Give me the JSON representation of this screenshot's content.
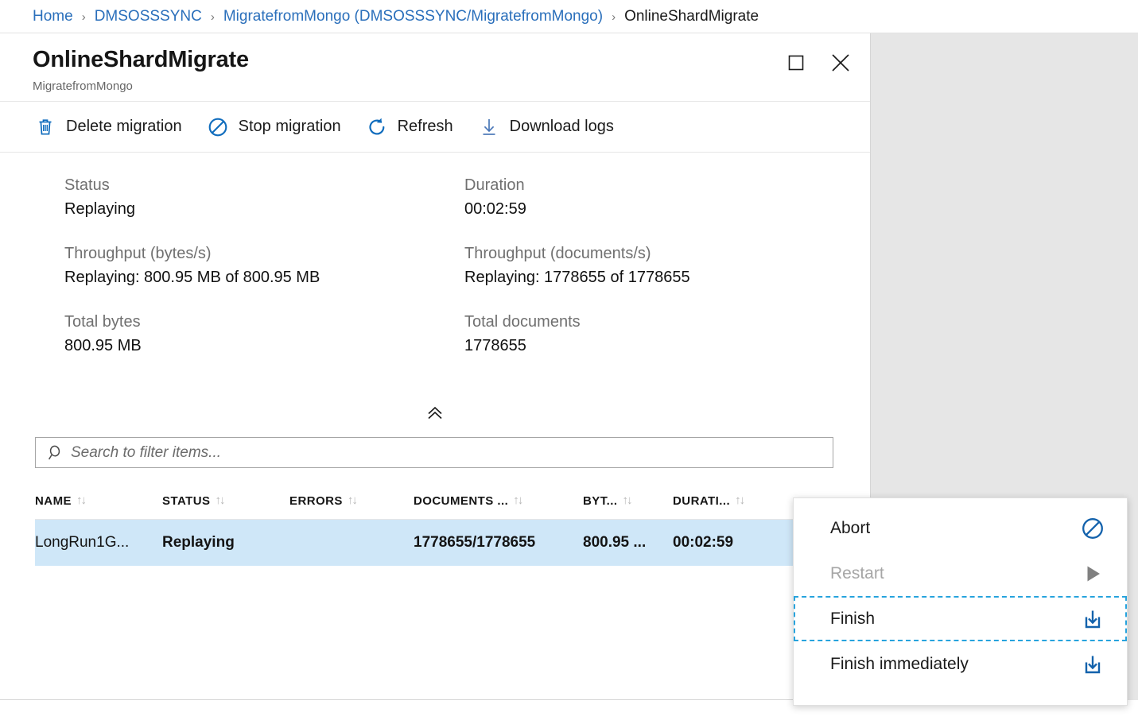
{
  "breadcrumb": {
    "separator": "›",
    "items": [
      {
        "label": "Home",
        "type": "link"
      },
      {
        "label": "DMSOSSSYNC",
        "type": "link"
      },
      {
        "label": "MigratefromMongo (DMSOSSSYNC/MigratefromMongo)",
        "type": "link"
      },
      {
        "label": "OnlineShardMigrate",
        "type": "current"
      }
    ]
  },
  "blade": {
    "title": "OnlineShardMigrate",
    "subtitle": "MigratefromMongo",
    "window_controls": [
      {
        "name": "maximize",
        "icon": "square-icon"
      },
      {
        "name": "close",
        "icon": "close-icon"
      }
    ]
  },
  "toolbar": {
    "items": [
      {
        "label": "Delete migration",
        "icon": "trash-icon"
      },
      {
        "label": "Stop migration",
        "icon": "no-entry-icon"
      },
      {
        "label": "Refresh",
        "icon": "refresh-icon"
      },
      {
        "label": "Download logs",
        "icon": "download-icon"
      }
    ]
  },
  "summary": {
    "left": [
      {
        "label": "Status",
        "value": "Replaying"
      },
      {
        "label": "Throughput (bytes/s)",
        "value": "Replaying: 800.95 MB of 800.95 MB"
      },
      {
        "label": "Total bytes",
        "value": "800.95 MB"
      }
    ],
    "right": [
      {
        "label": "Duration",
        "value": "00:02:59"
      },
      {
        "label": "Throughput (documents/s)",
        "value": "Replaying: 1778655 of 1778655"
      },
      {
        "label": "Total documents",
        "value": "1778655"
      }
    ],
    "collapse_icon": "double-chevron-up-icon"
  },
  "search": {
    "placeholder": "Search to filter items...",
    "value": "",
    "icon": "search-icon"
  },
  "table": {
    "sort_icon": "↑↓",
    "columns": [
      {
        "key": "name",
        "label": "NAME"
      },
      {
        "key": "status",
        "label": "STATUS"
      },
      {
        "key": "errors",
        "label": "ERRORS"
      },
      {
        "key": "documents",
        "label": "DOCUMENTS ..."
      },
      {
        "key": "bytes",
        "label": "BYT..."
      },
      {
        "key": "duration",
        "label": "DURATI..."
      }
    ],
    "rows": [
      {
        "name": "LongRun1G...",
        "status": "Replaying",
        "errors": "",
        "documents": "1778655/1778655",
        "bytes": "800.95 ...",
        "duration": "00:02:59",
        "selected": true
      }
    ]
  },
  "context_menu": {
    "items": [
      {
        "label": "Abort",
        "icon": "no-entry-icon",
        "state": "enabled"
      },
      {
        "label": "Restart",
        "icon": "play-triangle-icon",
        "state": "disabled"
      },
      {
        "label": "Finish",
        "icon": "download-box-icon",
        "state": "focused"
      },
      {
        "label": "Finish immediately",
        "icon": "download-box-icon",
        "state": "enabled"
      }
    ]
  },
  "colors": {
    "link": "#2a6fbb",
    "accent": "#0f6cbd",
    "row_selected": "#cfe7f8",
    "focus_outline": "#27a3dd",
    "backdrop": "#e6e6e6",
    "muted_text": "#707070"
  }
}
